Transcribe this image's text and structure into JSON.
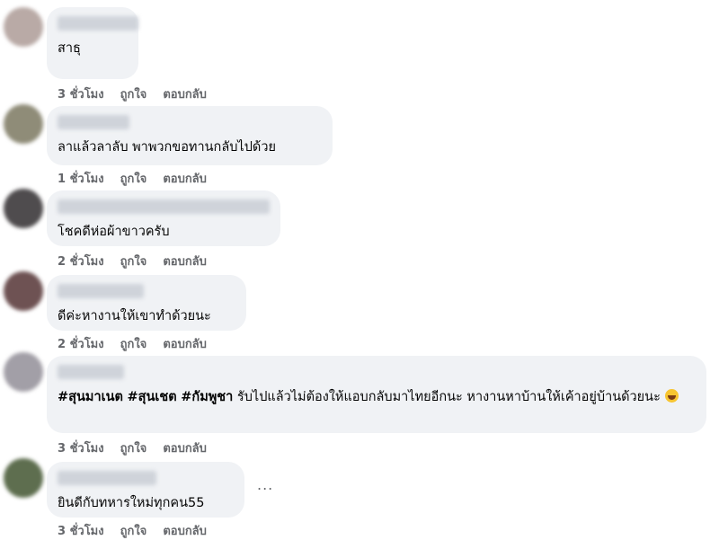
{
  "action_labels": {
    "like": "ถูกใจ",
    "reply": "ตอบกลับ"
  },
  "comments": [
    {
      "text": "สาธุ",
      "time": "3 ชั่วโมง"
    },
    {
      "text": "ลาแล้วลาลับ พาพวกขอทานกลับไปด้วย",
      "time": "1 ชั่วโมง"
    },
    {
      "text": "โชคดีห่อผ้าขาวครับ",
      "time": "2 ชั่วโมง"
    },
    {
      "text": "ดีค่ะหางานให้เขาทำด้วยนะ",
      "time": "2 ชั่วโมง"
    },
    {
      "tags": [
        "#สุนมาเนต",
        "#สุนเชต",
        "#กัมพูชา"
      ],
      "text": "รับไปแล้วไม่ต้องให้แอบกลับมาไทยอีกนะ หางานหาบ้านให้เค้าอยู่บ้านด้วยนะ",
      "emoji": "laughing-crying-emoji",
      "time": "3 ชั่วโมง"
    },
    {
      "text": "ยินดีกับทหารใหม่ทุกคน55",
      "time": "3 ชั่วโมง"
    }
  ],
  "more_options_label": "...",
  "colors": {
    "bubble": "#f0f2f5",
    "meta_text": "#65676b",
    "text": "#050505"
  }
}
